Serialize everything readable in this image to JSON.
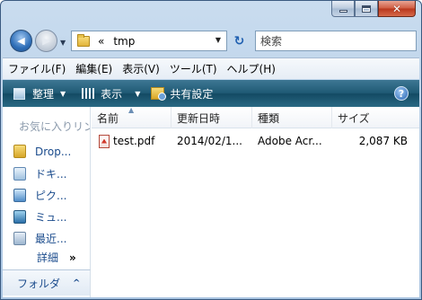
{
  "window": {
    "caption_buttons": {
      "minimize": "minimize-icon",
      "maximize": "maximize-icon",
      "close_glyph": "✕"
    }
  },
  "navigation": {
    "back_glyph": "◀",
    "forward_glyph": "▶",
    "dropdown_glyph": "▼"
  },
  "address_bar": {
    "chevron": "«",
    "path": "tmp",
    "dropdown_glyph": "▼"
  },
  "refresh_glyph": "↻",
  "search": {
    "placeholder": "検索"
  },
  "menu": {
    "items": [
      "ファイル(F)",
      "編集(E)",
      "表示(V)",
      "ツール(T)",
      "ヘルプ(H)"
    ]
  },
  "command_bar": {
    "organize": "整理",
    "view": "表示",
    "share": "共有設定",
    "arrow": "▼",
    "help_glyph": "?"
  },
  "nav_pane": {
    "favorites_header": "お気に入りリンク",
    "items": [
      {
        "label": "Drop...",
        "icon": "folder-icon"
      },
      {
        "label": "ドキ...",
        "icon": "documents-icon"
      },
      {
        "label": "ピク...",
        "icon": "pictures-icon"
      },
      {
        "label": "ミュ...",
        "icon": "music-icon"
      },
      {
        "label": "最近...",
        "icon": "recent-icon"
      }
    ],
    "details": "詳細",
    "details_chevron": "»",
    "folders_label": "フォルダ",
    "folders_chevron": "^"
  },
  "file_list": {
    "columns": [
      "名前",
      "更新日時",
      "種類",
      "サイズ"
    ],
    "sort_indicator": "▲",
    "rows": [
      {
        "name": "test.pdf",
        "modified": "2014/02/1...",
        "type": "Adobe Acr...",
        "size": "2,087 KB"
      }
    ]
  }
}
